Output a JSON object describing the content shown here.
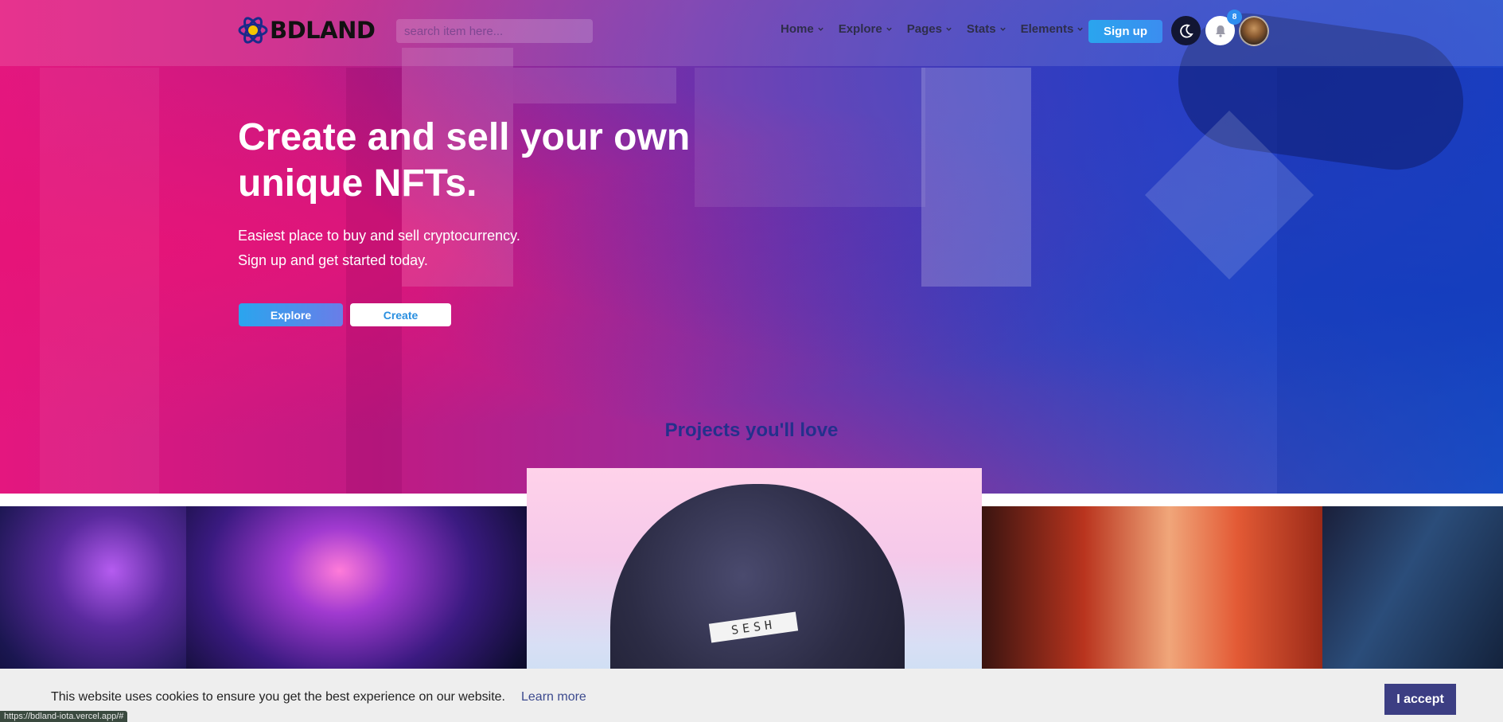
{
  "brand": {
    "name": "BDLAND"
  },
  "search": {
    "placeholder": "search item here..."
  },
  "nav": {
    "items": [
      {
        "label": "Home"
      },
      {
        "label": "Explore"
      },
      {
        "label": "Pages"
      },
      {
        "label": "Stats"
      },
      {
        "label": "Elements"
      }
    ],
    "signup_label": "Sign up",
    "notification_count": "8"
  },
  "hero": {
    "title": "Create and sell your own unique NFTs.",
    "subtitle_line1": "Easiest place to buy and sell cryptocurrency.",
    "subtitle_line2": "Sign up and get started today.",
    "explore_label": "Explore",
    "create_label": "Create"
  },
  "projects": {
    "title": "Projects you'll love",
    "featured_text": "SESH"
  },
  "cookie": {
    "message": "This website uses cookies to ensure you get the best experience on our website.",
    "learn_more": "Learn more",
    "accept_label": "I accept"
  },
  "statusbar": {
    "url": "https://bdland-iota.vercel.app/#"
  },
  "colors": {
    "accent": "#2aa5ee",
    "hero_pink": "#e4177f",
    "hero_blue": "#1e5ad0",
    "projects_title": "#24308c",
    "accept_button": "#3c3e83"
  }
}
